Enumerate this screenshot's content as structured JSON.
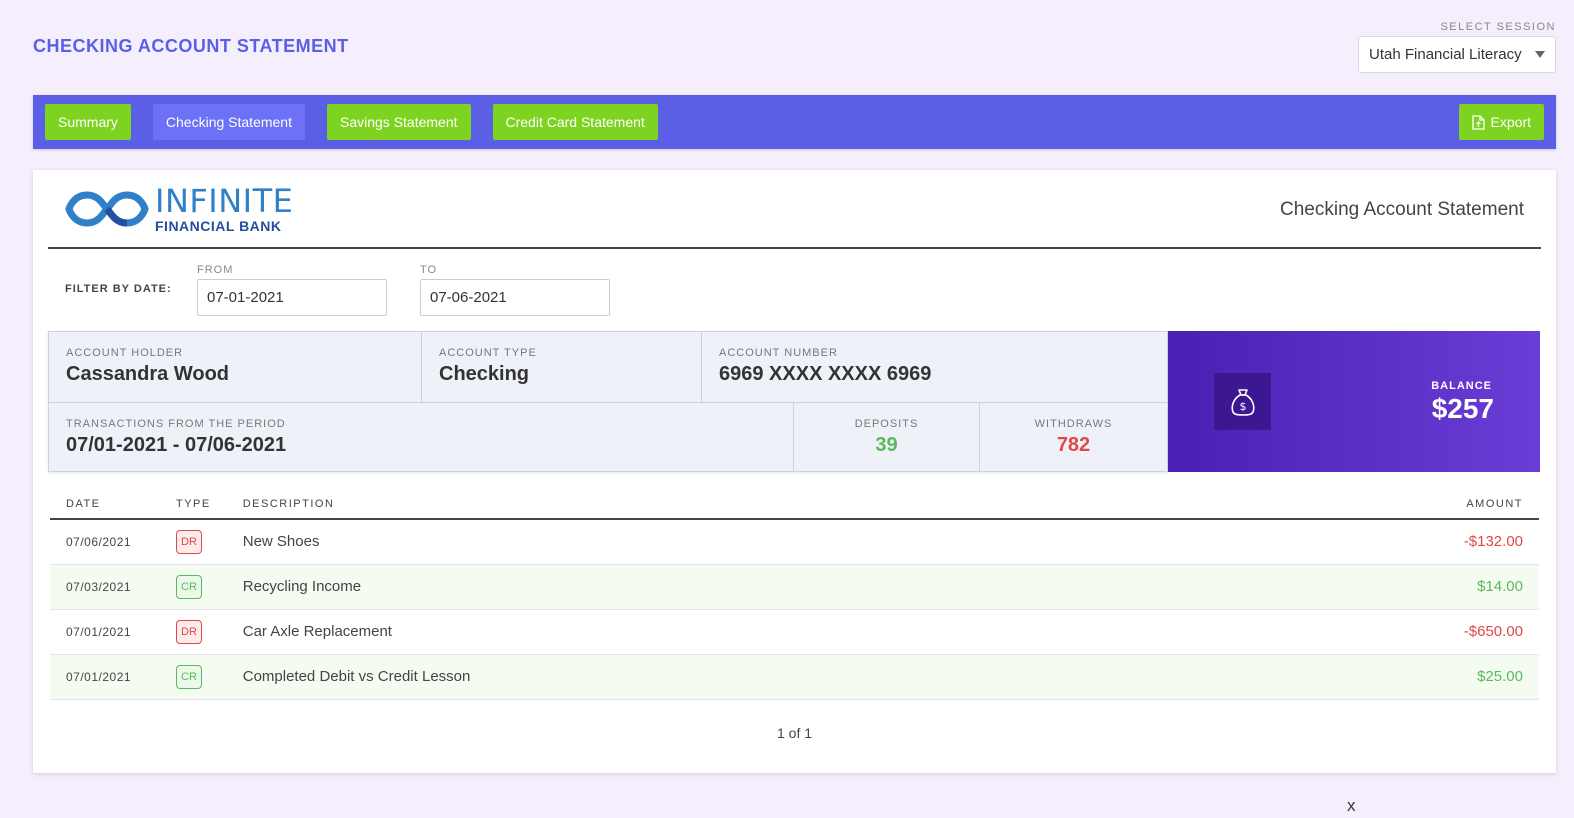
{
  "page": {
    "title": "CHECKING ACCOUNT STATEMENT"
  },
  "session": {
    "label": "SELECT SESSION",
    "selected": "Utah Financial Literacy"
  },
  "nav": {
    "tabs": [
      {
        "label": "Summary"
      },
      {
        "label": "Checking Statement",
        "active": true
      },
      {
        "label": "Savings Statement"
      },
      {
        "label": "Credit Card Statement"
      }
    ],
    "export_label": "Export"
  },
  "statement": {
    "logo_main": "INFINITE",
    "logo_sub": "FINANCIAL BANK",
    "title": "Checking Account Statement"
  },
  "filter": {
    "label": "FILTER BY DATE:",
    "from_label": "FROM",
    "from_value": "07-01-2021",
    "to_label": "TO",
    "to_value": "07-06-2021"
  },
  "account": {
    "holder_label": "ACCOUNT HOLDER",
    "holder": "Cassandra Wood",
    "type_label": "ACCOUNT TYPE",
    "type": "Checking",
    "number_label": "ACCOUNT NUMBER",
    "number": "6969 XXXX XXXX 6969",
    "period_label": "TRANSACTIONS FROM THE PERIOD",
    "period": "07/01-2021 - 07/06-2021",
    "deposits_label": "DEPOSITS",
    "deposits": "39",
    "withdraws_label": "WITHDRAWS",
    "withdraws": "782",
    "balance_label": "BALANCE",
    "balance": "$257"
  },
  "table": {
    "headers": {
      "date": "DATE",
      "type": "TYPE",
      "description": "DESCRIPTION",
      "amount": "AMOUNT"
    },
    "rows": [
      {
        "date": "07/06/2021",
        "type": "DR",
        "description": "New Shoes",
        "amount": "-$132.00"
      },
      {
        "date": "07/03/2021",
        "type": "CR",
        "description": "Recycling Income",
        "amount": "$14.00"
      },
      {
        "date": "07/01/2021",
        "type": "DR",
        "description": "Car Axle Replacement",
        "amount": "-$650.00"
      },
      {
        "date": "07/01/2021",
        "type": "CR",
        "description": "Completed Debit vs Credit Lesson",
        "amount": "$25.00"
      }
    ]
  },
  "pagination": {
    "text": "1 of 1"
  },
  "footer": {
    "close": "x"
  },
  "colors": {
    "primary": "#5b5fe6",
    "green": "#7ed321",
    "balance": "#4a1fb3",
    "debit": "#e04848",
    "credit": "#5cb85c"
  }
}
